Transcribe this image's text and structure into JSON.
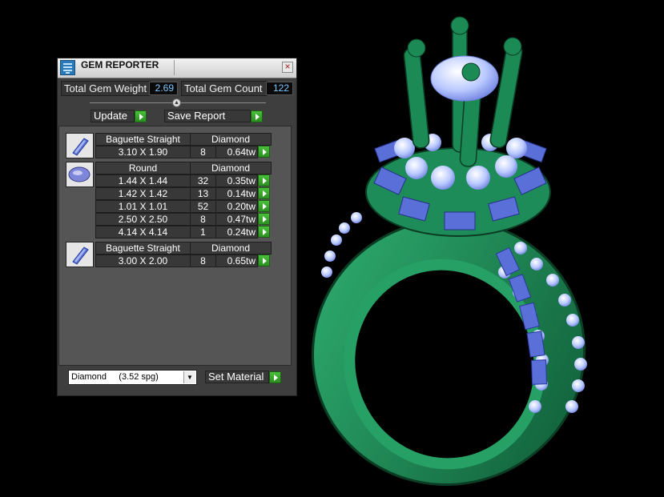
{
  "panel": {
    "title": "GEM REPORTER"
  },
  "stats": {
    "weight_label": "Total Gem Weight",
    "weight_value": "2.69",
    "count_label": "Total Gem Count",
    "count_value": "122"
  },
  "toolbar": {
    "update_label": "Update",
    "save_report_label": "Save Report"
  },
  "groups": [
    {
      "icon": "baguette-gem-icon",
      "cut": "Baguette Straight",
      "material": "Diamond",
      "rows": [
        {
          "size": "3.10 X 1.90",
          "count": "8",
          "tw": "0.64tw"
        }
      ]
    },
    {
      "icon": "round-gem-icon",
      "cut": "Round",
      "material": "Diamond",
      "rows": [
        {
          "size": "1.44 X 1.44",
          "count": "32",
          "tw": "0.35tw"
        },
        {
          "size": "1.42 X 1.42",
          "count": "13",
          "tw": "0.14tw"
        },
        {
          "size": "1.01 X 1.01",
          "count": "52",
          "tw": "0.20tw"
        },
        {
          "size": "2.50 X 2.50",
          "count": "8",
          "tw": "0.47tw"
        },
        {
          "size": "4.14 X 4.14",
          "count": "1",
          "tw": "0.24tw"
        }
      ]
    },
    {
      "icon": "baguette-gem-icon",
      "cut": "Baguette Straight",
      "material": "Diamond",
      "rows": [
        {
          "size": "3.00 X 2.00",
          "count": "8",
          "tw": "0.65tw"
        }
      ]
    }
  ],
  "material": {
    "selected": "Diamond     (3.52 spg)",
    "set_label": "Set Material"
  },
  "colors": {
    "ring_green": "#1f8a57",
    "gem_blue": "#5a6fd8",
    "gem_light": "#c8d6ff",
    "accent_green": "#3cb52c"
  }
}
